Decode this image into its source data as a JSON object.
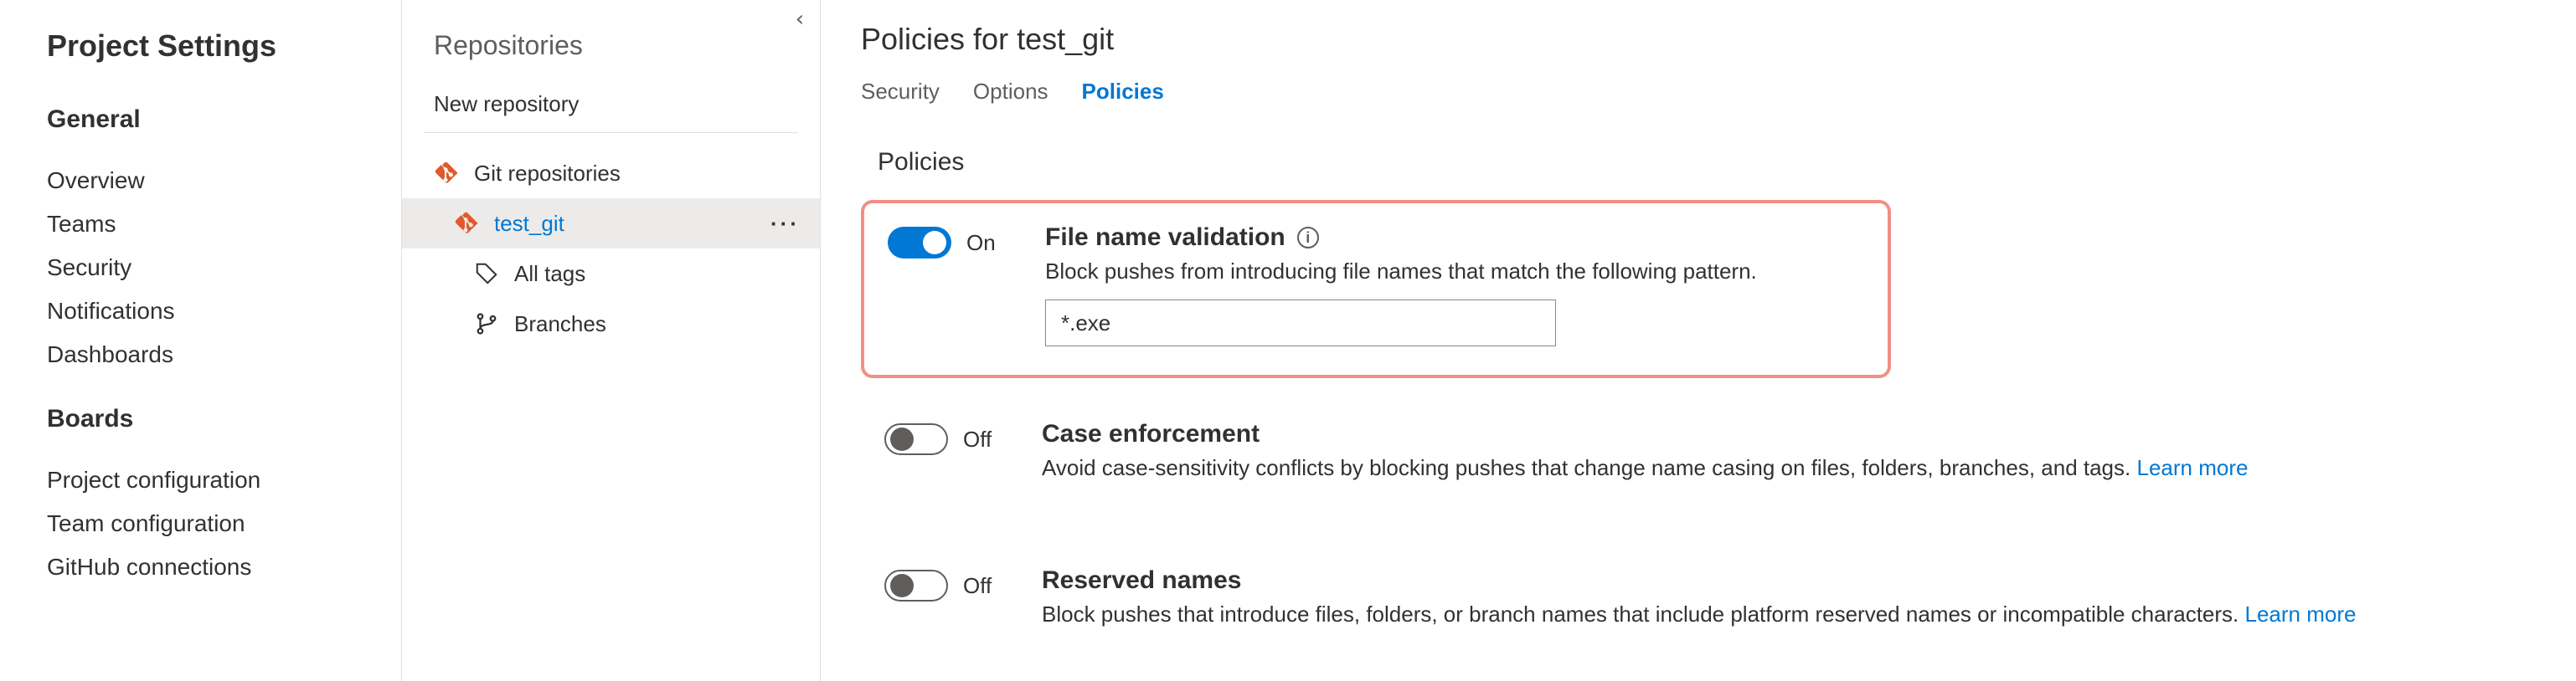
{
  "settings": {
    "title": "Project Settings",
    "sections": [
      {
        "heading": "General",
        "items": [
          "Overview",
          "Teams",
          "Security",
          "Notifications",
          "Dashboards"
        ]
      },
      {
        "heading": "Boards",
        "items": [
          "Project configuration",
          "Team configuration",
          "GitHub connections"
        ]
      }
    ]
  },
  "repos": {
    "title": "Repositories",
    "new_label": "New repository",
    "root": "Git repositories",
    "selected": "test_git",
    "children": [
      "All tags",
      "Branches"
    ]
  },
  "main": {
    "page_title": "Policies for test_git",
    "tabs": {
      "security": "Security",
      "options": "Options",
      "policies": "Policies"
    },
    "section_heading": "Policies",
    "toggle_on": "On",
    "toggle_off": "Off",
    "learn_more": "Learn more",
    "policies": {
      "file_validation": {
        "title": "File name validation",
        "desc": "Block pushes from introducing file names that match the following pattern.",
        "pattern": "*.exe"
      },
      "case_enforcement": {
        "title": "Case enforcement",
        "desc": "Avoid case-sensitivity conflicts by blocking pushes that change name casing on files, folders, branches, and tags."
      },
      "reserved_names": {
        "title": "Reserved names",
        "desc": "Block pushes that introduce files, folders, or branch names that include platform reserved names or incompatible characters."
      }
    }
  }
}
